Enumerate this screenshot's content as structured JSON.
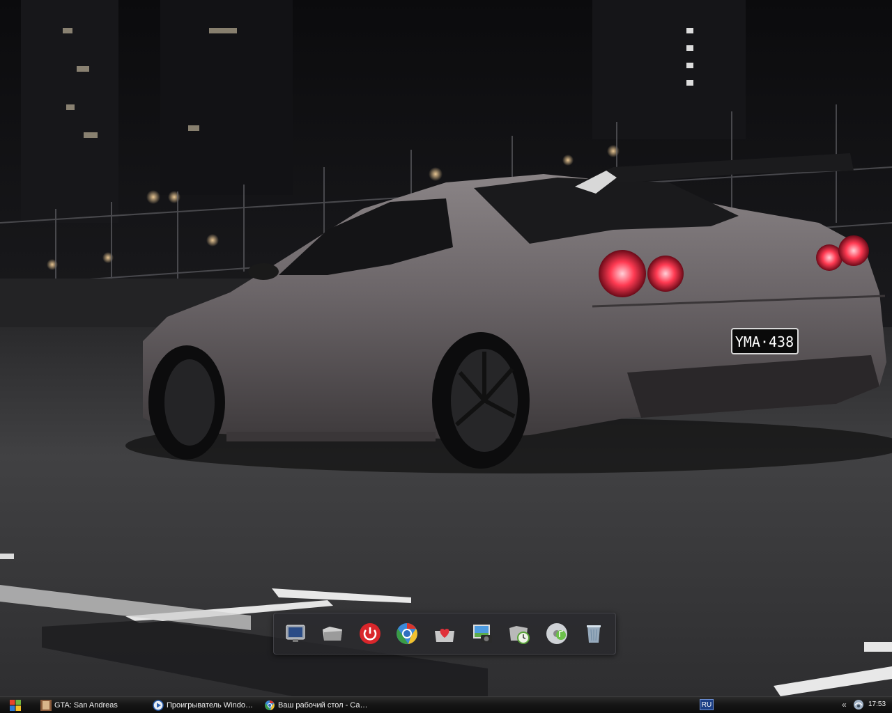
{
  "screen": {
    "wallpaper_description_colors": {
      "sky": "#0d0d10",
      "road": "#3a3a3c",
      "car_body": "#6a6467",
      "tail_light": "#ff3a52"
    }
  },
  "wallpaper": {
    "plate_text": "YMA·438"
  },
  "dock": {
    "items": [
      {
        "name": "my-computer",
        "icon": "monitor-icon"
      },
      {
        "name": "documents",
        "icon": "folder-icon"
      },
      {
        "name": "shutdown",
        "icon": "power-icon"
      },
      {
        "name": "chrome",
        "icon": "chrome-icon"
      },
      {
        "name": "favorites",
        "icon": "heart-folder-icon"
      },
      {
        "name": "pictures",
        "icon": "photo-camera-icon"
      },
      {
        "name": "scheduler",
        "icon": "clock-folder-icon"
      },
      {
        "name": "music",
        "icon": "music-disc-icon"
      },
      {
        "name": "recycle-bin",
        "icon": "trash-icon"
      }
    ]
  },
  "taskbar": {
    "tasks": [
      {
        "label": "GTA: San Andreas",
        "icon": "gta-icon"
      },
      {
        "label": "Проигрыватель Windows...",
        "icon": "media-player-icon"
      },
      {
        "label": "Ваш рабочий стол - Сам...",
        "icon": "chrome-icon"
      }
    ],
    "language": "RU",
    "tray_expand": "«",
    "clock": "17:53",
    "colors": {
      "bar": "#111111",
      "lang_bg": "#1c3f86"
    }
  }
}
